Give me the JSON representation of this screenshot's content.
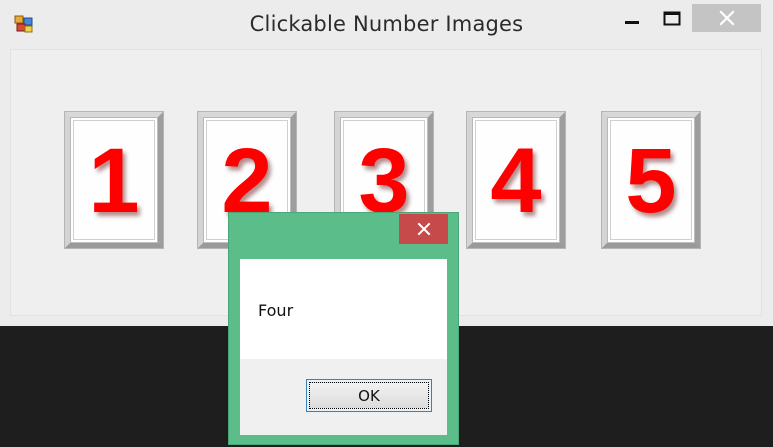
{
  "window": {
    "title": "Clickable Number Images",
    "icon": "app-icon"
  },
  "title_buttons": {
    "minimize": "minimize-icon",
    "maximize": "maximize-icon",
    "close": "close-icon"
  },
  "tiles": [
    {
      "digit": "1"
    },
    {
      "digit": "2"
    },
    {
      "digit": "3"
    },
    {
      "digit": "4"
    },
    {
      "digit": "5"
    }
  ],
  "message_box": {
    "text": "Four",
    "ok_label": "OK",
    "close_icon": "close-icon"
  },
  "colors": {
    "digit": "#ff0000",
    "dialog_frame": "#5bbd8a",
    "dialog_close": "#c74a4a",
    "window_close_hover": "#c4c4c4",
    "desktop": "#1e1e1e"
  }
}
